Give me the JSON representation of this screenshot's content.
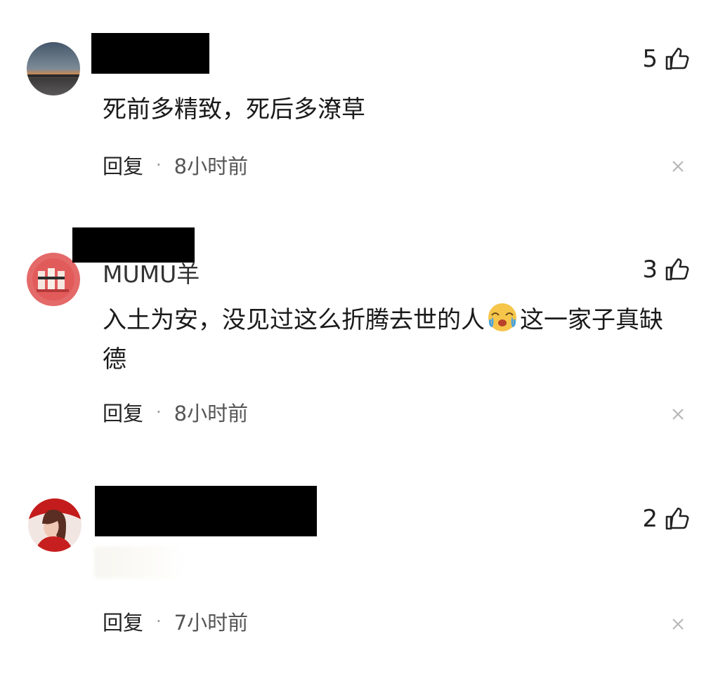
{
  "comments": [
    {
      "username": "",
      "likes": "5",
      "text": "死前多精致，死后多潦草",
      "reply_label": "回复",
      "separator": "·",
      "time": "8小时前"
    },
    {
      "username": "MUMU羊",
      "likes": "3",
      "text_before_emoji": "入土为安，没见过这么折腾去世的人",
      "emoji": "crying-face-icon",
      "text_after_emoji": "这一家子真缺德",
      "reply_label": "回复",
      "separator": "·",
      "time": "8小时前"
    },
    {
      "username": "",
      "likes": "2",
      "text": "",
      "reply_label": "回复",
      "separator": "·",
      "time": "7小时前"
    }
  ],
  "colors": {
    "redaction": "#000000",
    "text": "#1a1a1a",
    "muted": "#9a9a9a"
  }
}
